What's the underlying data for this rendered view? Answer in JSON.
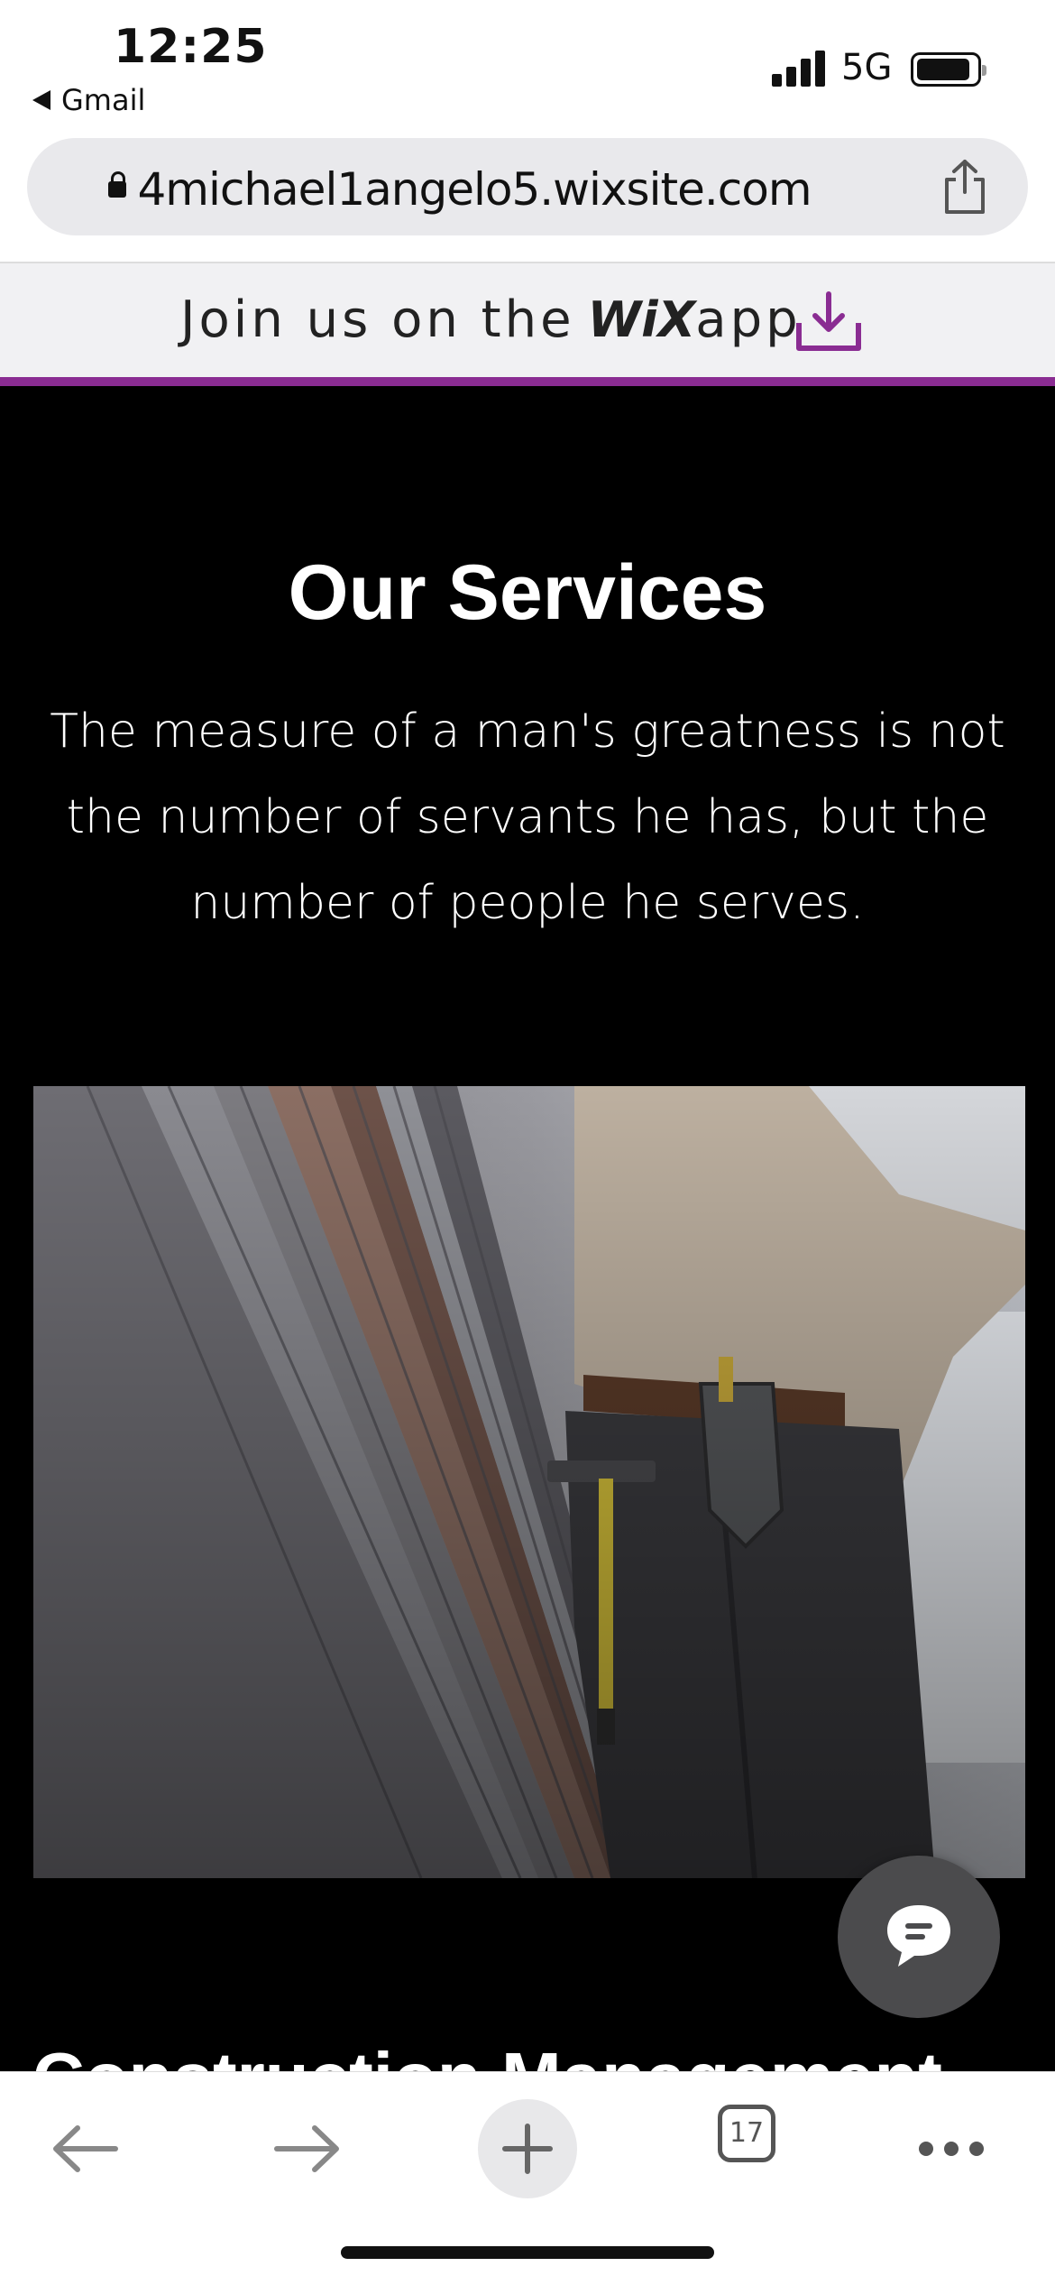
{
  "status_bar": {
    "time": "12:25",
    "back_app": "Gmail",
    "network": "5G",
    "icons": [
      "signal-icon",
      "battery-icon",
      "back-arrow-icon"
    ]
  },
  "browser": {
    "url": "4michael1angelo5.wixsite.com",
    "tab_count": "17",
    "icons": [
      "lock-icon",
      "share-icon",
      "back-arrow-icon",
      "forward-arrow-icon",
      "plus-icon",
      "tabs-icon",
      "more-icon"
    ]
  },
  "wix_banner": {
    "text": "Join us on the",
    "logo": "WiX",
    "suffix": "app",
    "accent_color": "#8a2c92",
    "icon": "download-icon"
  },
  "page": {
    "title": "Our Services",
    "quote": "The measure of a man's greatness is not the number of servants he has, but the number of people he serves.",
    "image": "photo of construction worker with tool belt and hammer next to siding",
    "next_section_heading": "Construction Management",
    "chat_icon": "chat-icon"
  }
}
